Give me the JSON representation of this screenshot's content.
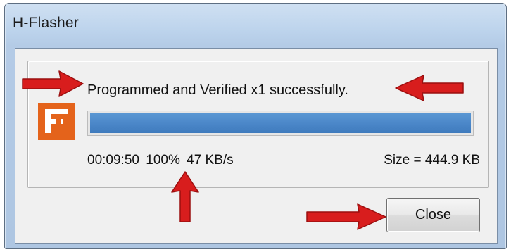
{
  "window": {
    "title": "H-Flasher"
  },
  "dialog": {
    "status_text": "Programmed and Verified x1 successfully.",
    "progress_percent": 100,
    "stats": {
      "elapsed": "00:09:50",
      "percent": "100%",
      "rate": "47 KB/s"
    },
    "size_text": "Size = 444.9 KB",
    "close_label": "Close"
  },
  "icons": {
    "app_logo": "h-flasher-logo-icon",
    "annotation": "red-arrow-icon"
  },
  "colors": {
    "logo_orange": "#e4631b",
    "progress_blue": "#4a86c8",
    "annotation_red": "#d81d1d"
  }
}
